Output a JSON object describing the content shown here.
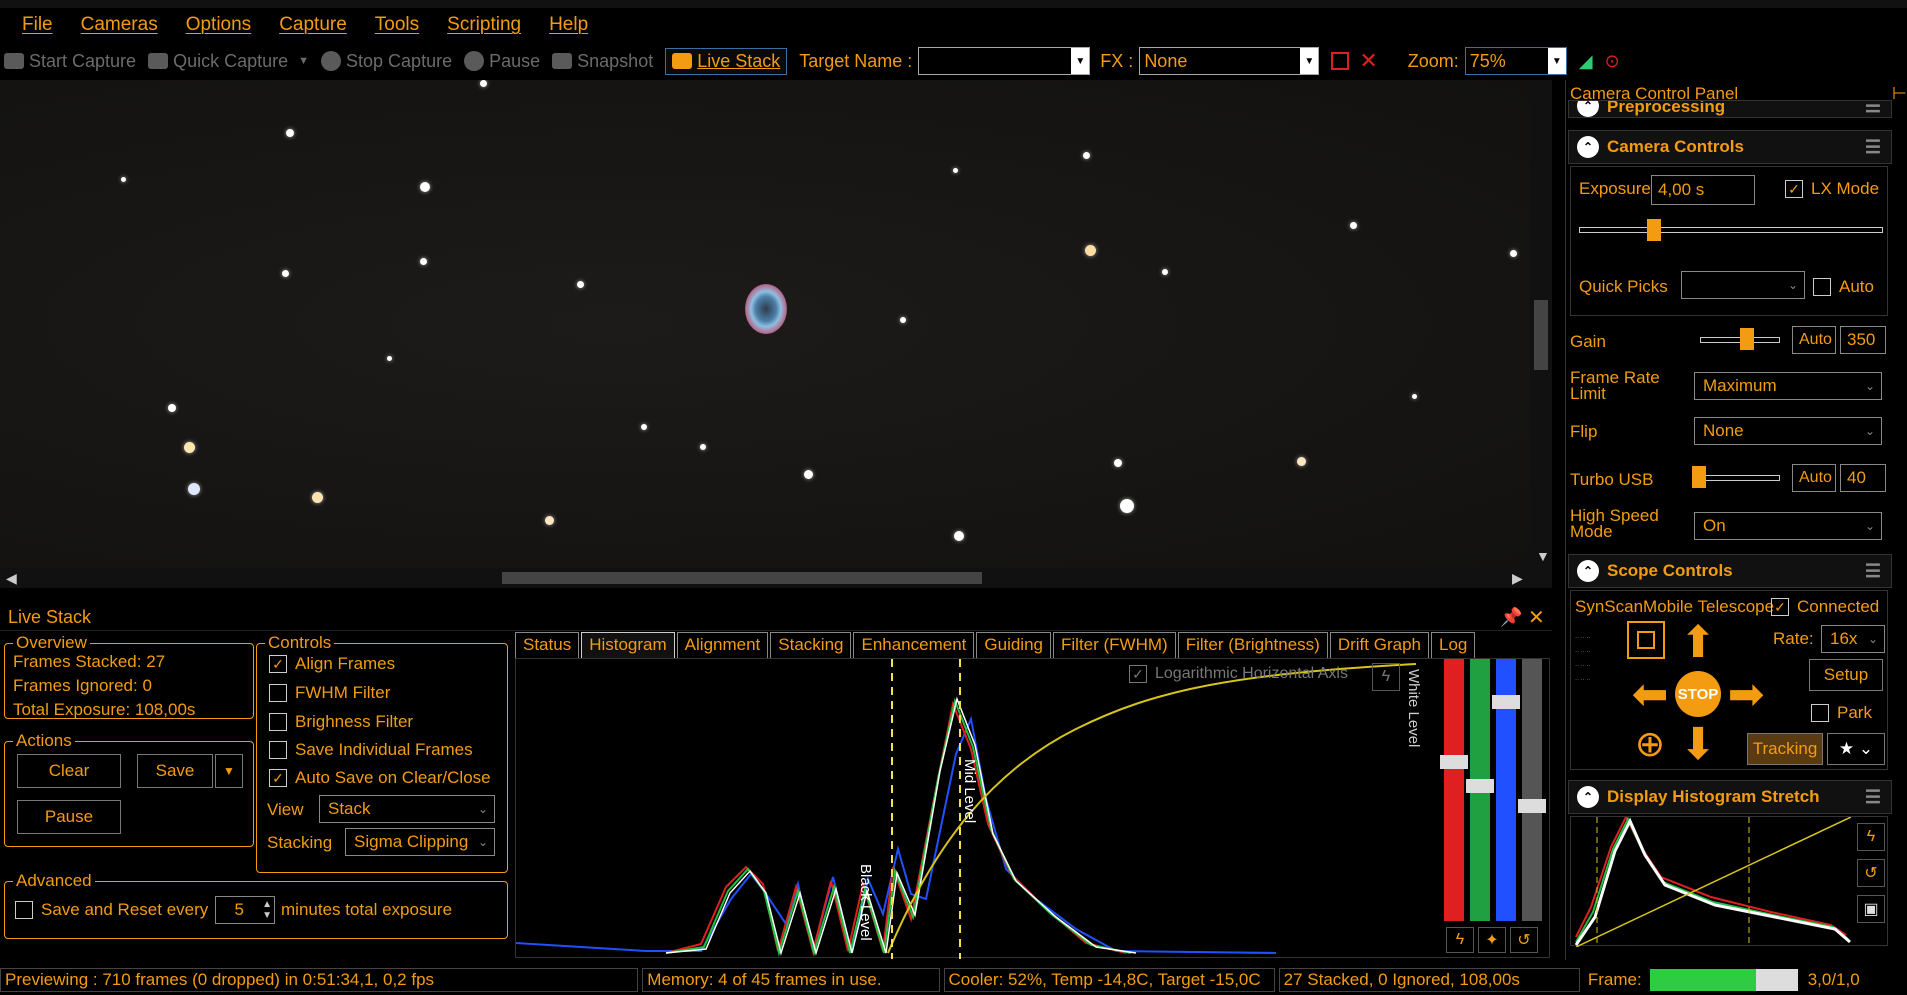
{
  "menu": {
    "items": [
      "File",
      "Cameras",
      "Options",
      "Capture",
      "Tools",
      "Scripting",
      "Help"
    ]
  },
  "toolbar": {
    "start_capture": "Start Capture",
    "quick_capture": "Quick Capture",
    "stop_capture": "Stop Capture",
    "pause": "Pause",
    "snapshot": "Snapshot",
    "live_stack": "Live Stack",
    "target_name_label": "Target Name :",
    "target_name_value": "",
    "fx_label": "FX :",
    "fx_value": "None",
    "zoom_label": "Zoom:",
    "zoom_value": "75%"
  },
  "live_stack": {
    "title": "Live Stack",
    "overview": {
      "title": "Overview",
      "frames_stacked": "Frames Stacked: 27",
      "frames_ignored": "Frames Ignored:  0",
      "total_exposure": "Total Exposure:   108,00s"
    },
    "actions": {
      "title": "Actions",
      "clear": "Clear",
      "save": "Save",
      "pause": "Pause"
    },
    "advanced": {
      "title": "Advanced",
      "save_reset_label": "Save and Reset every",
      "minutes_value": "5",
      "minutes_label": "minutes total exposure"
    },
    "controls": {
      "title": "Controls",
      "align_frames": "Align Frames",
      "fwhm_filter": "FWHM Filter",
      "brightness_filter": "Brighness Filter",
      "save_individual": "Save Individual Frames",
      "auto_save": "Auto Save on Clear/Close",
      "view_label": "View",
      "view_value": "Stack",
      "stacking_label": "Stacking",
      "stacking_value": "Sigma Clipping"
    },
    "tabs": [
      "Status",
      "Histogram",
      "Alignment",
      "Stacking",
      "Enhancement",
      "Guiding",
      "Filter (FWHM)",
      "Filter (Brightness)",
      "Drift Graph",
      "Log"
    ],
    "histogram": {
      "log_axis_label": "Logarithmic Horizontal Axis",
      "black_level": "Black Level",
      "mid_level": "Mid Level",
      "white_level": "White Level"
    }
  },
  "ccp": {
    "title": "Camera Control Panel",
    "preprocessing": "Preprocessing",
    "camera_controls": "Camera Controls",
    "exposure_label": "Exposure",
    "exposure_value": "4,00 s",
    "lx_mode": "LX Mode",
    "quick_picks": "Quick Picks",
    "auto": "Auto",
    "gain_label": "Gain",
    "gain_value": "350",
    "frame_rate_label": "Frame Rate Limit",
    "frame_rate_value": "Maximum",
    "flip_label": "Flip",
    "flip_value": "None",
    "turbo_label": "Turbo USB",
    "turbo_value": "40",
    "hsm_label": "High Speed Mode",
    "hsm_value": "On",
    "scope_controls": "Scope Controls",
    "telescope": "SynScanMobile Telescope",
    "connected": "Connected",
    "rate_label": "Rate:",
    "rate_value": "16x",
    "setup": "Setup",
    "park": "Park",
    "tracking": "Tracking",
    "stop": "STOP",
    "histogram_stretch": "Display Histogram Stretch"
  },
  "status": {
    "previewing": "Previewing : 710 frames (0 dropped) in 0:51:34,1, 0,2 fps",
    "memory": "Memory: 4 of 45 frames in use.",
    "cooler": "Cooler: 52%, Temp -14,8C, Target -15,0C",
    "stacked": "27 Stacked, 0 Ignored, 108,00s",
    "frame_label": "Frame:",
    "frame_progress": 0.72,
    "frame_value": "3,0/1,0"
  },
  "colors": {
    "accent": "#f39c12",
    "background": "#000000"
  }
}
